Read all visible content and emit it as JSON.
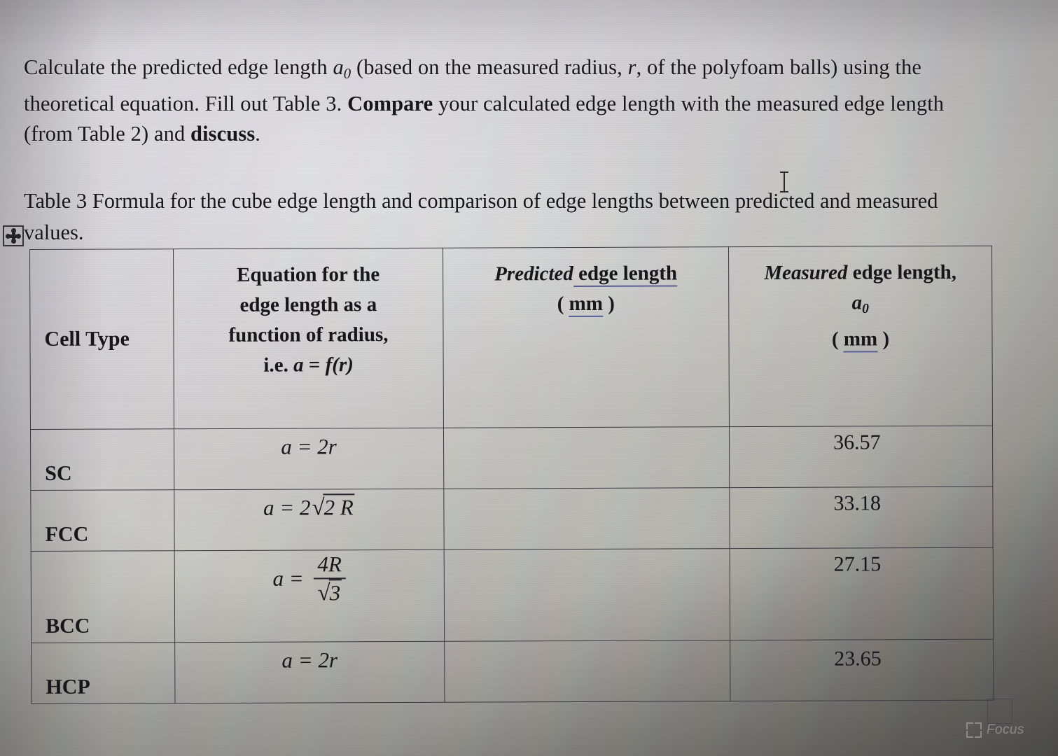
{
  "document": {
    "intro_paragraph": {
      "run1": "Calculate the predicted edge length ",
      "italic_symbol": "a",
      "italic_subscript": "0",
      "run2": " (based on the measured radius, ",
      "italic_r": "r",
      "run3": ", of the polyfoam balls) using the theoretical equation. Fill out Table 3. ",
      "bold_compare": "Compare",
      "run4": " your calculated edge length with the measured edge length (from Table 2) and ",
      "bold_discuss": "discuss",
      "run5": "."
    },
    "caption": {
      "full_text": "Table 3 Formula for the cube edge length and comparison of edge lengths between predicted and measured values.",
      "line1": "Table 3 Formula for the cube edge length and comparison of edge lengths between predicted",
      "line2": "and measured values."
    }
  },
  "table": {
    "headers": {
      "cell_type": "Cell Type",
      "equation": {
        "line1": "Equation for the",
        "line2": "edge length as a",
        "line3": "function of radius,",
        "line4_prefix": "i.e. ",
        "line4_a": "a",
        "line4_eq": " = ",
        "line4_f": "f(r)"
      },
      "predicted": {
        "italic_word": "Predicted",
        "rest": " edge length",
        "unit_open": "( ",
        "unit": "mm",
        "unit_close": " )"
      },
      "measured": {
        "italic_word": "Measured",
        "rest": " edge length,",
        "symbol": "a",
        "symbol_sub": "0",
        "unit_open": "( ",
        "unit": "mm",
        "unit_close": " )"
      }
    },
    "rows": [
      {
        "cell_type": "SC",
        "equation_text": "a = 2r",
        "equation_parts": {
          "lhs": "a",
          "eq": " = ",
          "coef": "2",
          "var": "r"
        },
        "predicted": "",
        "measured": "36.57"
      },
      {
        "cell_type": "FCC",
        "equation_text": "a = 2√2 R",
        "equation_parts": {
          "lhs": "a",
          "eq": " = ",
          "coef": "2",
          "radical": "√",
          "radicand": "2 R"
        },
        "predicted": "",
        "measured": "33.18"
      },
      {
        "cell_type": "BCC",
        "equation_text": "a = 4R/√3",
        "equation_parts": {
          "lhs": "a",
          "eq": " = ",
          "numerator": "4R",
          "denominator_radical": "√",
          "denominator": "3"
        },
        "predicted": "",
        "measured": "27.15"
      },
      {
        "cell_type": "HCP",
        "equation_text": "a = 2r",
        "equation_parts": {
          "lhs": "a",
          "eq": " = ",
          "coef": "2",
          "var": "r"
        },
        "predicted": "",
        "measured": "23.65"
      }
    ]
  },
  "watermark": {
    "label": "Focus",
    "icon": "focus-bracket-icon"
  },
  "colors": {
    "text": "#17161a",
    "table_border": "#3a3840",
    "spellcheck_underline": "#5b5f92",
    "page_background_light": "#cfccd4",
    "page_background_dark": "#56524f",
    "watermark_text": "#d8d4cf"
  }
}
